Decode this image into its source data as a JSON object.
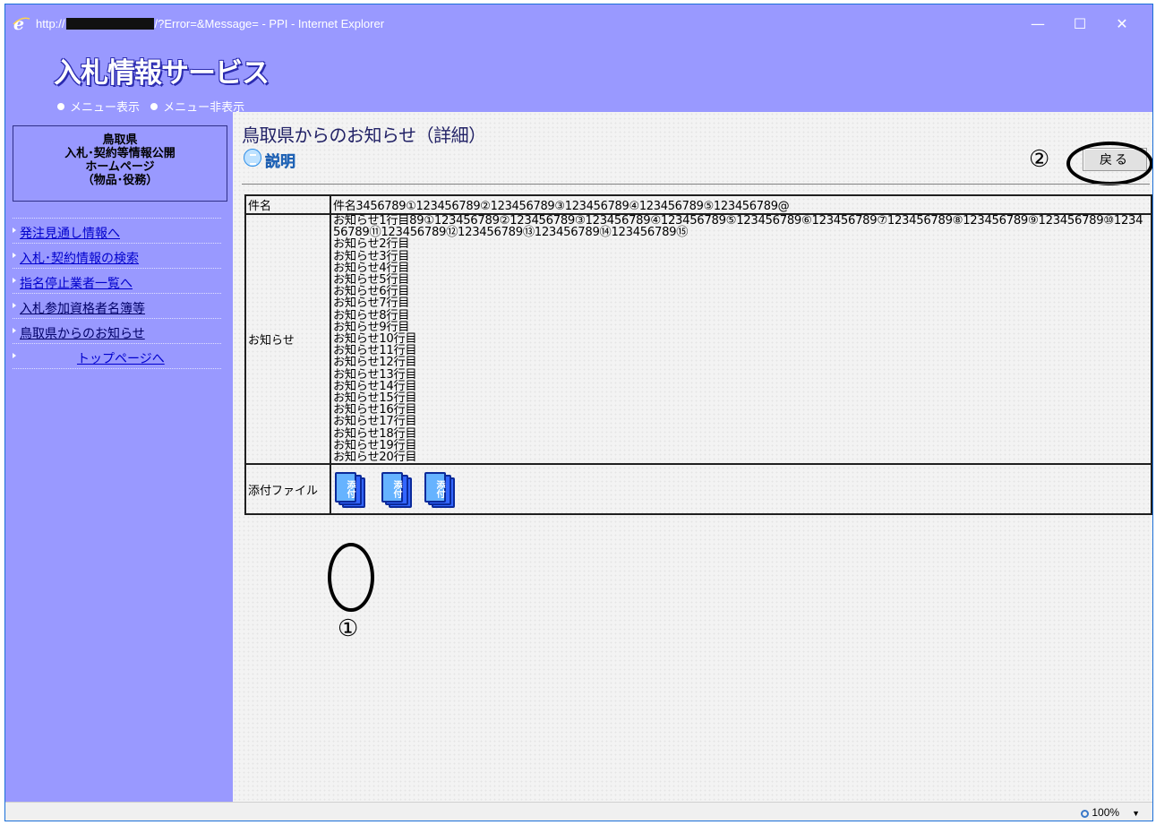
{
  "window": {
    "url_prefix": "http://",
    "url_suffix": "/?Error=&Message= - PPI - Internet Explorer",
    "btn_min": "—",
    "btn_max": "☐",
    "btn_close": "✕"
  },
  "header": {
    "logo_text": "入札情報サービス",
    "radio_show": "メニュー表示",
    "radio_hide": "メニュー非表示"
  },
  "sidebar": {
    "box_lines": [
      "鳥取県",
      "入札･契約等情報公開",
      "ホームページ",
      "（物品･役務）"
    ],
    "items": [
      {
        "label": "発注見通し情報へ"
      },
      {
        "label": "入札･契約情報の検索"
      },
      {
        "label": "指名停止業者一覧へ"
      },
      {
        "label": "入札参加資格者名簿等"
      },
      {
        "label": "鳥取県からのお知らせ"
      },
      {
        "label": "トップページへ"
      }
    ]
  },
  "main": {
    "title": "鳥取県からのお知らせ（詳細）",
    "explain_label": "説明",
    "back_button": "戻る",
    "callout_1": "①",
    "callout_2": "②",
    "table": {
      "subject_label": "件名",
      "subject_value": "件名3456789①123456789②123456789③123456789④123456789⑤123456789@",
      "notice_label": "お知らせ",
      "notice_lines": [
        "お知らせ1行目89①123456789②123456789③123456789④123456789⑤123456789⑥123456789⑦123456789⑧123456789⑨123456789⑩123456789⑪123456789⑫123456789⑬123456789⑭123456789⑮",
        "お知らせ2行目",
        "お知らせ3行目",
        "お知らせ4行目",
        "お知らせ5行目",
        "お知らせ6行目",
        "お知らせ7行目",
        "お知らせ8行目",
        "お知らせ9行目",
        "お知らせ10行目",
        "お知らせ11行目",
        "お知らせ12行目",
        "お知らせ13行目",
        "お知らせ14行目",
        "お知らせ15行目",
        "お知らせ16行目",
        "お知らせ17行目",
        "お知らせ18行目",
        "お知らせ19行目",
        "お知らせ20行目"
      ],
      "attach_label": "添付ファイル",
      "attach_icon_text": "添付"
    }
  },
  "status": {
    "zoom": "100%",
    "dropdown": "▼"
  }
}
